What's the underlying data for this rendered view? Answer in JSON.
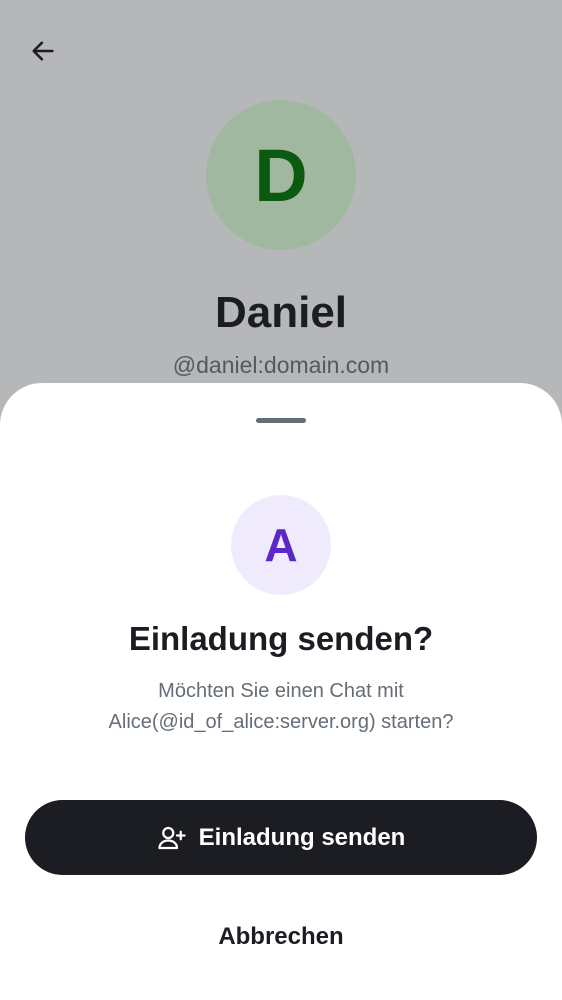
{
  "background_screen": {
    "back_icon": "arrow-left-icon",
    "avatar_letter": "D",
    "avatar_color": "#a1b8a0",
    "name": "Daniel",
    "handle": "@daniel:domain.com"
  },
  "sheet": {
    "avatar_letter": "A",
    "avatar_color": "#efebfd",
    "avatar_text_color": "#5b27c8",
    "title": "Einladung senden?",
    "message": "Möchten Sie einen Chat mit Alice(@id_of_alice:server.org) starten?",
    "primary_button": {
      "icon": "user-add-icon",
      "label": "Einladung senden"
    },
    "cancel_button": {
      "label": "Abbrechen"
    }
  }
}
